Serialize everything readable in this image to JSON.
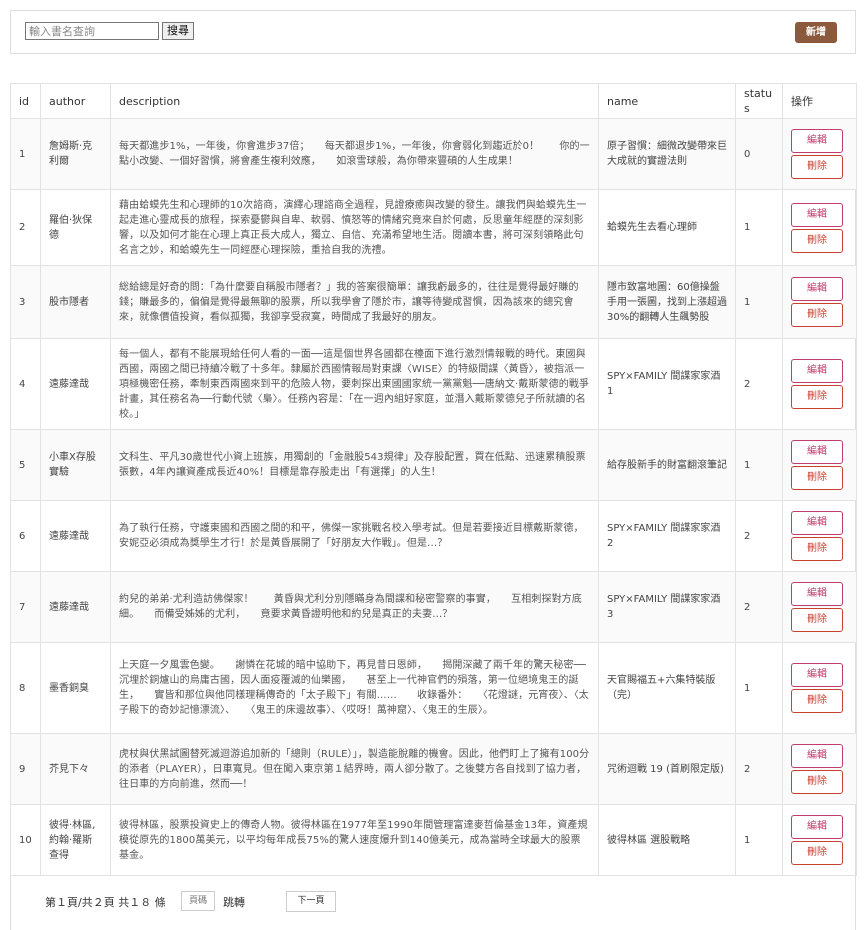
{
  "toolbar": {
    "search_placeholder": "輸入書名查詢",
    "search_label": "搜尋",
    "add_label": "新增"
  },
  "colors": {
    "add_button": "#8b5a3c",
    "edit_border": "#c23b6e",
    "delete_border": "#c9402f"
  },
  "table": {
    "headers": {
      "id": "id",
      "author": "author",
      "description": "description",
      "name": "name",
      "status": "status",
      "ops": "操作"
    },
    "edit_label": "編輯",
    "delete_label": "刪除",
    "rows": [
      {
        "id": "1",
        "author": "詹姆斯·克利爾",
        "description": "每天都進步1%，一年後，你會進步37倍；　　每天都退步1%，一年後，你會弱化到趨近於0！　　你的一點小改變、一個好習慣，將會產生複利效應，　　如滾雪球般，為你帶來豐碩的人生成果！",
        "name": "原子習慣：細微改變帶來巨大成就的實證法則",
        "status": "0"
      },
      {
        "id": "2",
        "author": "羅伯·狄保德",
        "description": "藉由蛤蟆先生和心理師的10次諮商，演繹心理諮商全過程，見證療癒與改變的發生。讓我們與蛤蟆先生一起走進心靈成長的旅程，探索憂鬱與自卑、軟弱、憤怒等的情緒究竟來自於何處，反思童年經歷的深刻影響，以及如何才能在心理上真正長大成人，獨立、自信、充滿希望地生活。閱讀本書，將可深刻領略此句名言之妙，和蛤蟆先生一同經歷心理探險，重拾自我的洗禮。",
        "name": "蛤蟆先生去看心理師",
        "status": "1"
      },
      {
        "id": "3",
        "author": "股市隱者",
        "description": "総給總是好奇的問：「為什麼要自稱股市隱者？」我的答案很簡單：讓我虧最多的，往往是覺得最好賺的錢；賺最多的，偏偏是覺得最無聊的股票，所以我學會了隱於市，讓等待變成習慣，因為該來的總究會來，就像價值投資，看似孤獨，我卻享受寂寞，時間成了我最好的朋友。",
        "name": "隱市致富地圖：60億操盤手用一張圖，找到上漲超過30%的翻轉人生飆勢股",
        "status": "1"
      },
      {
        "id": "4",
        "author": "遠藤達哉",
        "description": "每一個人，都有不能展現給任何人看的一面──這是個世界各國都在檯面下進行激烈情報戰的時代。東國與西國，兩國之間已持續冷戰了十多年。隸屬於西國情報局對東課〈WISE〉的特級間諜〈黃昏〉，被指派一項極機密任務，牽制東西兩國來到平的危險人物，要刺探出東國國家統一黨黨魁──唐納文·戴斯蒙德的戰爭計畫，其任務名為──行動代號〈梟〉。任務內容是：「在一週內組好家庭，並潛入戴斯蒙德兒子所就讀的名校。」",
        "name": "SPY×FAMILY 間諜家家酒 1",
        "status": "2"
      },
      {
        "id": "5",
        "author": "小車X存股實驗",
        "description": "文科生、平凡30歲世代小資上班族，用獨創的「金融股543規律」及存股配置，買在低點、迅速累積股票張數，4年內讓資產成長近40%！目標是靠存股走出「有選擇」的人生！",
        "name": "給存股新手的財富翻滾筆記",
        "status": "1"
      },
      {
        "id": "6",
        "author": "遠藤達哉",
        "description": "為了執行任務，守護東國和西國之間的和平，佛傑一家挑戰名校入學考試。但是若要接近目標戴斯蒙德，安妮亞必須成為獎學生才行！於是黃昏展開了「好朋友大作戰」。但是…？",
        "name": "SPY×FAMILY 間諜家家酒 2",
        "status": "2"
      },
      {
        "id": "7",
        "author": "遠藤達哉",
        "description": "約兒的弟弟·尤利造訪佛傑家！　　黃昏與尤利分別隱瞞身為間諜和秘密警察的事實，　　互相刺探對方底細。　　而備受姊姊的尤利，　　竟要求黃昏證明他和約兒是真正的夫妻…？",
        "name": "SPY×FAMILY 間諜家家酒 3",
        "status": "2"
      },
      {
        "id": "8",
        "author": "墨香銅臭",
        "description": "上天庭一夕風雲色變。　　謝憐在花城的暗中協助下，再見昔日恩師，　　揭開深藏了兩千年的驚天秘密──　　沉埋於銅爐山的烏庸古國，因人面疫覆滅的仙樂國，　　甚至上一代神官們的殞落，第一位絕境鬼王的誕生，　　實皆和那位與他同樣理稱傳奇的「太子殿下」有關……　　收錄番外：　　〈花燈謎，元宵夜〉、〈太子殿下的奇妙記憶漂流〉、　　〈鬼王的床邊故事〉、〈哎呀！萬神窟〉、〈鬼王的生辰〉。",
        "name": "天官賜福五+六集特裝版（完）",
        "status": "1"
      },
      {
        "id": "9",
        "author": "芥見下々",
        "description": "虎杖與伏黑試圖替死滅迴游追加新的「總則（RULE）」，製造能脫離的機會。因此，他們盯上了擁有100分的添者（PLAYER），日車寬見。但在闖入東京第１結界時，兩人卻分散了。之後雙方各自找到了協力者，往日車的方向前進，然而──！",
        "name": "咒術迴戰 19 (首刷限定版)",
        "status": "2"
      },
      {
        "id": "10",
        "author": "彼得·林區, 約翰·羅斯查得",
        "description": "彼得林區，股票投資史上的傳奇人物。彼得林區在1977年至1990年間管理富達麥哲倫基金13年，資產規模從原先的1800萬美元，以平均每年成長75%的驚人速度爆升到140億美元，成為當時全球最大的股票基金。",
        "name": "彼得林區 選股戰略",
        "status": "1"
      }
    ]
  },
  "pagination": {
    "info": "第１頁/共２頁 共１８ 條",
    "page_input_placeholder": "頁碼",
    "jump_label": "跳轉",
    "next_label": "下一頁"
  }
}
